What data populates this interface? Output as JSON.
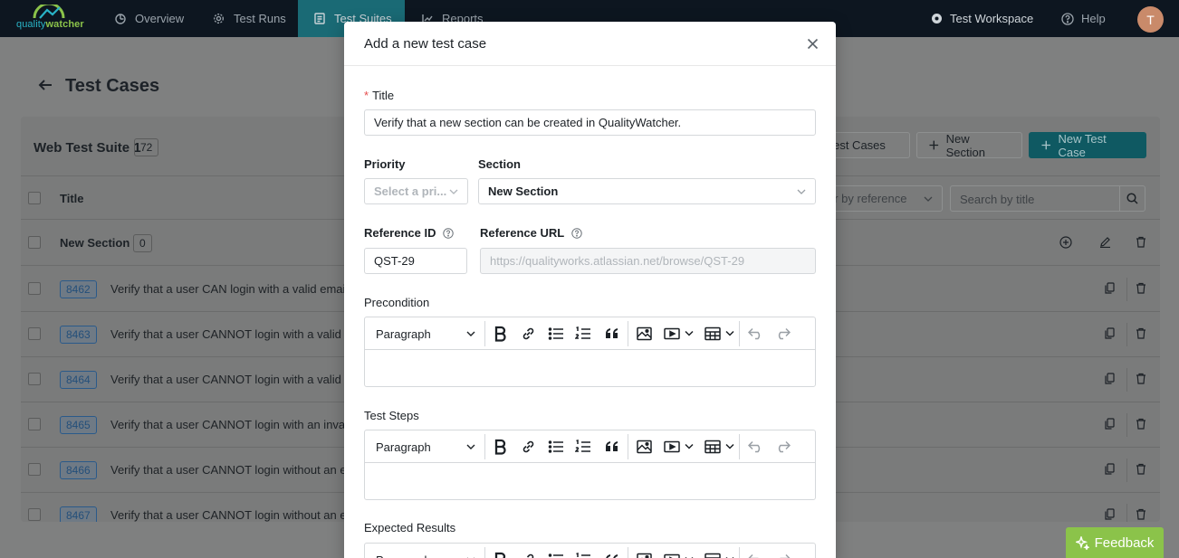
{
  "nav": {
    "logo_prefix": "quality",
    "logo_suffix": "watcher",
    "items": [
      {
        "label": "Overview",
        "icon": "dashboard-icon"
      },
      {
        "label": "Test Runs",
        "icon": "gear-icon"
      },
      {
        "label": "Test Suites",
        "icon": "document-icon",
        "active": true
      },
      {
        "label": "Reports",
        "icon": "chart-icon"
      }
    ],
    "workspace": "Test Workspace",
    "help": "Help",
    "avatar_initial": "T"
  },
  "page": {
    "title": "Test Cases",
    "suite_name": "Web Test Suite",
    "suite_number": "1",
    "suite_count": "72",
    "btn_import": "e Test Cases",
    "btn_new_section": "New Section",
    "btn_new_case": "New Test Case",
    "col_title": "Title",
    "filter_ref": "er by reference",
    "search_placeholder": "Search by title",
    "section": {
      "name": "New Section",
      "count": "0"
    },
    "rows": [
      {
        "id": "8462",
        "title": "Verify that a user CAN login with a valid email a"
      },
      {
        "id": "8463",
        "title": "Verify that a user CANNOT login with a valid em"
      },
      {
        "id": "8464",
        "title": "Verify that a user CANNOT login with a valid em"
      },
      {
        "id": "8465",
        "title": "Verify that a user CANNOT login with an invalid"
      },
      {
        "id": "8466",
        "title": "Verify that a user CANNOT login without an ema"
      },
      {
        "id": "8467",
        "title": "Verify that a user CANNOT login without an em"
      }
    ],
    "feedback": "Feedback"
  },
  "modal": {
    "title": "Add a new test case",
    "title_label": "Title",
    "required_mark": "*",
    "title_value": "Verify that a new section can be created in QualityWatcher.",
    "priority_label": "Priority",
    "priority_placeholder": "Select a pri...",
    "section_label": "Section",
    "section_value": "New Section",
    "ref_id_label": "Reference ID",
    "ref_id_value": "QST-29",
    "ref_url_label": "Reference URL",
    "ref_url_placeholder": "https://qualityworks.atlassian.net/browse/QST-29",
    "precondition_label": "Precondition",
    "steps_label": "Test Steps",
    "expected_label": "Expected Results",
    "paragraph": "Paragraph"
  },
  "colors": {
    "nav_bg": "#0d1620",
    "nav_active": "#1a6a75",
    "primary": "#0f5962",
    "feedback": "#8bc34a",
    "required": "#e54b4b"
  }
}
